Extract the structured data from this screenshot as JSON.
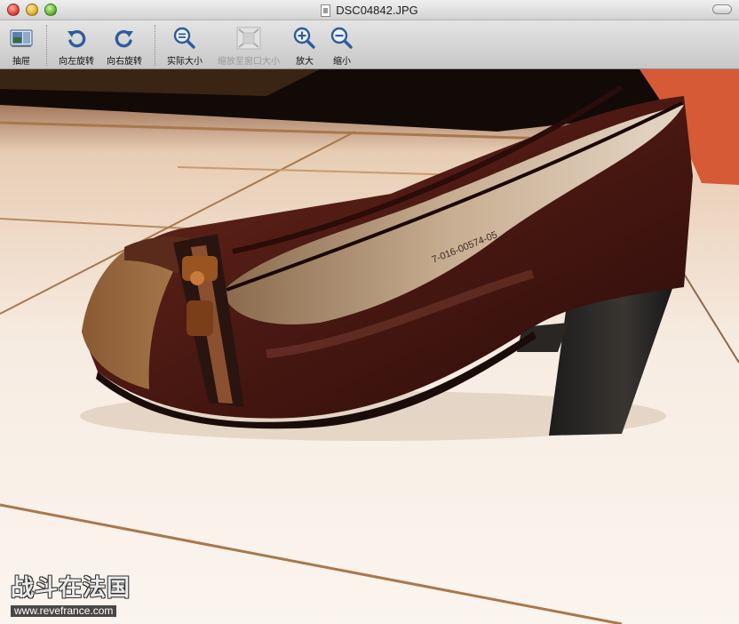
{
  "window": {
    "title": "DSC04842.JPG"
  },
  "toolbar": {
    "drawer": {
      "label": "抽屉",
      "icon": "drawer-icon"
    },
    "rotate_left": {
      "label": "向左旋转",
      "icon": "rotate-left-icon"
    },
    "rotate_right": {
      "label": "向右旋转",
      "icon": "rotate-right-icon"
    },
    "actual_size": {
      "label": "实际大小",
      "icon": "actual-size-icon"
    },
    "zoom_to_fit": {
      "label": "缩放至窗口大小",
      "icon": "zoom-to-fit-icon",
      "enabled": false
    },
    "zoom_in": {
      "label": "放大",
      "icon": "zoom-in-icon"
    },
    "zoom_out": {
      "label": "缩小",
      "icon": "zoom-out-icon"
    }
  },
  "photo": {
    "shoe_stamp": "7-016-00574-05",
    "watermark": {
      "text": "战斗在法国",
      "url": "www.revefrance.com"
    }
  },
  "colors": {
    "icon_blue": "#2d5c9e",
    "leather": "#4a1a14",
    "floor": "#f4e9dd",
    "grout": "#a8784c"
  }
}
